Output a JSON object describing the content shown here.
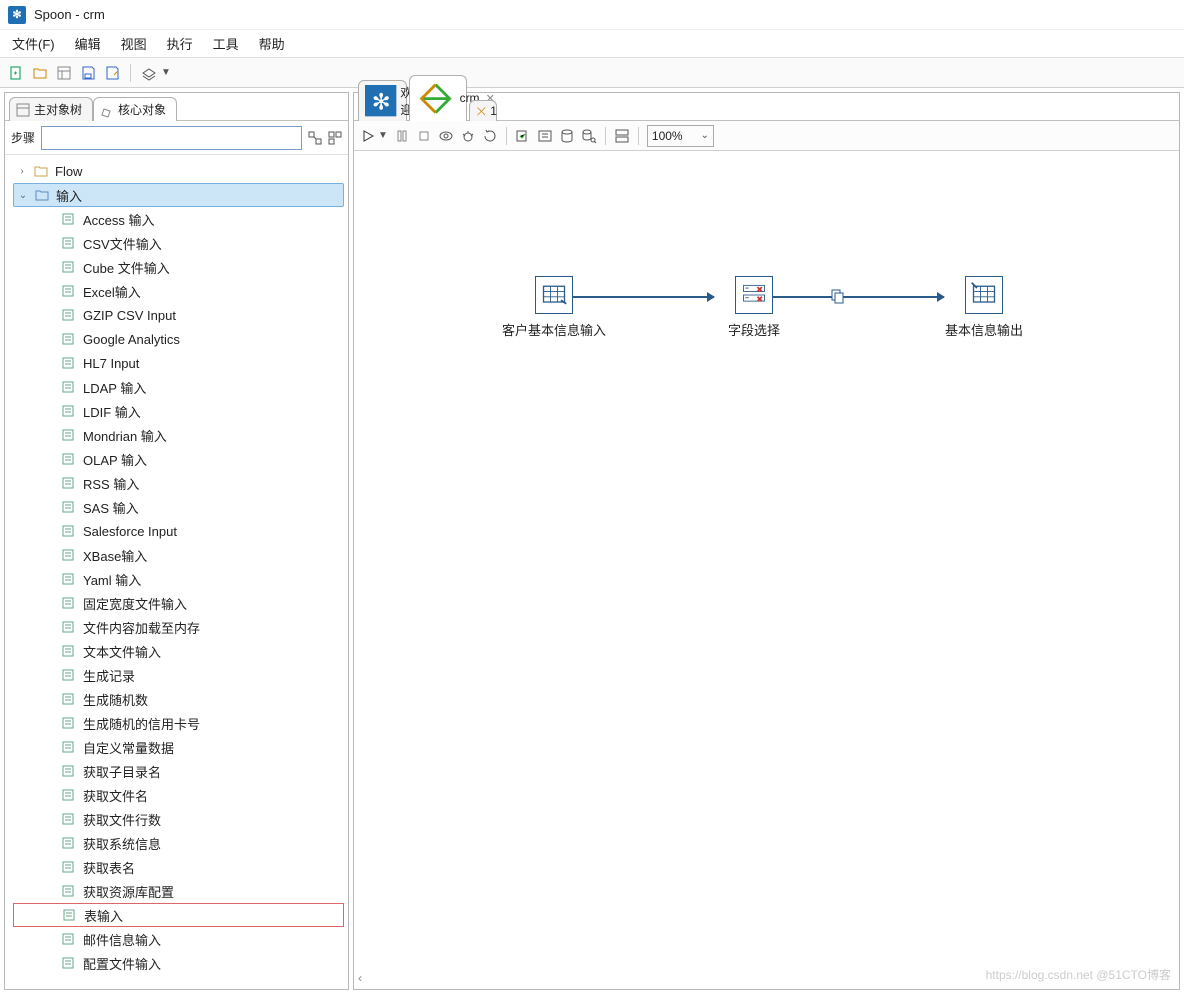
{
  "window": {
    "title": "Spoon - crm"
  },
  "menu": {
    "file": "文件(F)",
    "edit": "编辑",
    "view": "视图",
    "run": "执行",
    "tools": "工具",
    "help": "帮助"
  },
  "sidebar": {
    "tabs": {
      "main": "主对象树",
      "core": "核心对象"
    },
    "search_label": "步骤",
    "search_value": "",
    "tree": {
      "flow": "Flow",
      "input": "输入",
      "items": [
        "Access 输入",
        "CSV文件输入",
        "Cube 文件输入",
        "Excel输入",
        "GZIP CSV Input",
        "Google Analytics",
        "HL7 Input",
        "LDAP 输入",
        "LDIF 输入",
        "Mondrian 输入",
        "OLAP 输入",
        "RSS 输入",
        "SAS 输入",
        "Salesforce Input",
        "XBase输入",
        "Yaml 输入",
        "固定宽度文件输入",
        "文件内容加载至内存",
        "文本文件输入",
        "生成记录",
        "生成随机数",
        "生成随机的信用卡号",
        "自定义常量数据",
        "获取子目录名",
        "获取文件名",
        "获取文件行数",
        "获取系统信息",
        "获取表名",
        "获取资源库配置",
        "表输入",
        "邮件信息输入",
        "配置文件输入"
      ],
      "highlighted_index": 29
    }
  },
  "canvas": {
    "tabs": {
      "welcome": "欢迎!",
      "crm": "crm",
      "one": "1"
    },
    "zoom": "100%",
    "nodes": {
      "n1": "客户基本信息输入",
      "n2": "字段选择",
      "n3": "基本信息输出"
    }
  },
  "watermark": "https://blog.csdn.net @51CTO博客"
}
